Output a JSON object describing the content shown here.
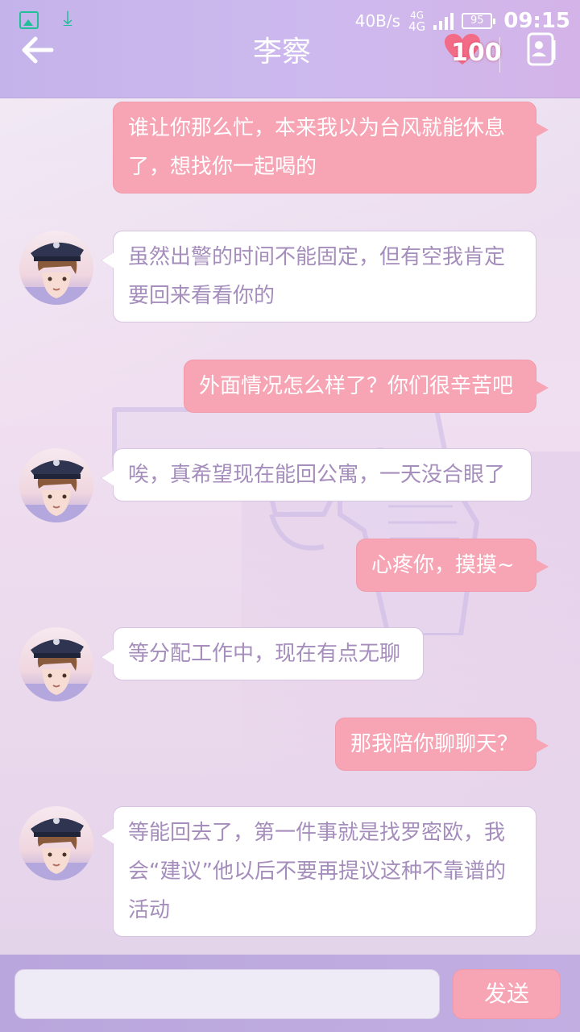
{
  "status_bar": {
    "speed": "40B/s",
    "network_top": "4G",
    "network_bottom": "4G",
    "battery": "95",
    "time": "09:15"
  },
  "header": {
    "title": "李察",
    "heart_value": "100"
  },
  "messages": [
    {
      "sender": "me",
      "text": "谁让你那么忙，本来我以为台风就能休息了，想找你一起喝的"
    },
    {
      "sender": "them",
      "text": "虽然出警的时间不能固定，但有空我肯定要回来看看你的"
    },
    {
      "sender": "me",
      "text": "外面情况怎么样了？你们很辛苦吧"
    },
    {
      "sender": "them",
      "text": "唉，真希望现在能回公寓，一天没合眼了"
    },
    {
      "sender": "me",
      "text": "心疼你，摸摸~"
    },
    {
      "sender": "them",
      "text": "等分配工作中，现在有点无聊"
    },
    {
      "sender": "me",
      "text": "那我陪你聊聊天？"
    },
    {
      "sender": "them",
      "text": "等能回去了，第一件事就是找罗密欧，我会“建议”他以后不要再提议这种不靠谱的活动"
    }
  ],
  "input": {
    "value": "",
    "placeholder": ""
  },
  "send_label": "发送",
  "colors": {
    "header": "#c9b6ec",
    "my_bubble": "#f7a4b4",
    "their_bubble": "#ffffff",
    "their_text": "#a58dbc",
    "status_icons": "#1fbf9a"
  },
  "icons": {
    "back": "back-arrow-icon",
    "heart": "heart-icon",
    "contact": "contact-card-icon",
    "gallery": "image-icon",
    "download": "download-icon"
  }
}
